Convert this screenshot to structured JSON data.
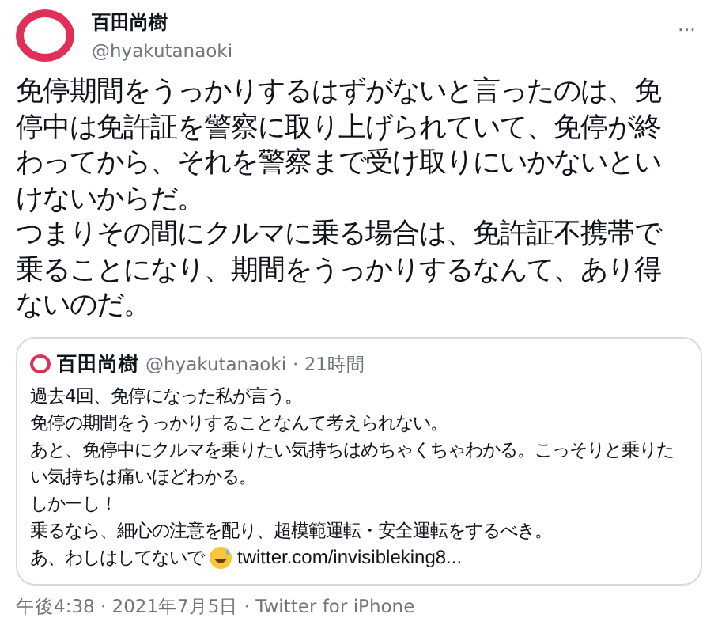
{
  "author": {
    "name": "百田尚樹",
    "handle": "@hyakutanaoki"
  },
  "more": "···",
  "paragraphs": [
    "免停期間をうっかりするはずがないと言ったのは、免停中は免許証を警察に取り上げられていて、免停が終わってから、それを警察まで受け取りにいかないといけないからだ。",
    "つまりその間にクルマに乗る場合は、免許証不携帯で乗ることになり、期間をうっかりするなんて、あり得ないのだ。"
  ],
  "quote": {
    "name": "百田尚樹",
    "handle": "@hyakutanaoki",
    "time": "· 21時間",
    "lines": [
      "過去4回、免停になった私が言う。",
      "免停の期間をうっかりすることなんて考えられない。",
      "あと、免停中にクルマを乗りたい気持ちはめちゃくちゃわかる。こっそりと乗りたい気持ちは痛いほどわかる。",
      "しかーし！",
      "乗るなら、細心の注意を配り、超模範運転・安全運転をするべき。"
    ],
    "last_line": {
      "text": "あ、わしはしてないで",
      "link": "twitter.com/invisibleking8..."
    }
  },
  "footer": "午後4:38 · 2021年7月5日 · Twitter for iPhone"
}
